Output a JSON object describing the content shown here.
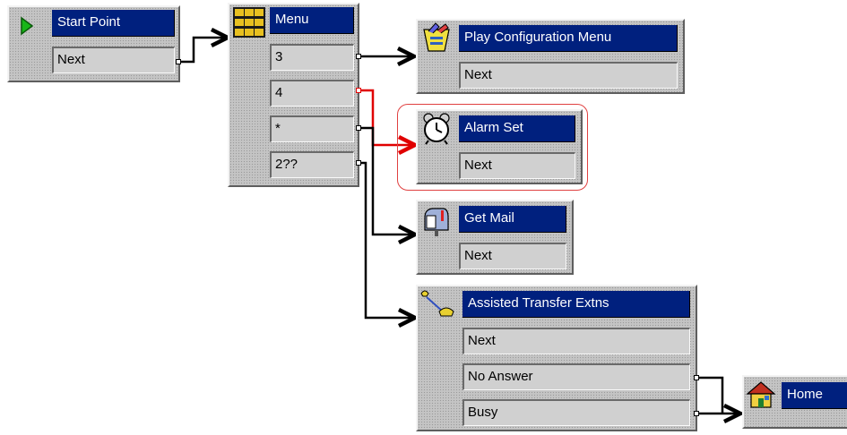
{
  "nodes": {
    "start_point": {
      "title": "Start Point",
      "exits": [
        "Next"
      ]
    },
    "menu": {
      "title": "Menu",
      "exits": [
        "3",
        "4",
        "*",
        "2??"
      ]
    },
    "play_configuration_menu": {
      "title": "Play Configuration Menu",
      "exits": [
        "Next"
      ]
    },
    "alarm_set": {
      "title": "Alarm Set",
      "exits": [
        "Next"
      ]
    },
    "get_mail": {
      "title": "Get Mail",
      "exits": [
        "Next"
      ]
    },
    "assisted_transfer_extns": {
      "title": "Assisted Transfer Extns",
      "exits": [
        "Next",
        "No Answer",
        "Busy"
      ]
    },
    "home": {
      "title": "Home"
    }
  },
  "colors": {
    "title_bar": "#00207e",
    "connector": "#000000",
    "selected_connector": "#e00000",
    "highlight": "#e04040"
  },
  "icons": {
    "start_point": "green-play-arrow-icon",
    "menu": "keypad-grid-icon",
    "play_configuration_menu": "configuration-icon",
    "alarm_set": "alarm-clock-icon",
    "get_mail": "mailbox-icon",
    "assisted_transfer_extns": "telephone-transfer-icon",
    "home": "house-icon"
  }
}
